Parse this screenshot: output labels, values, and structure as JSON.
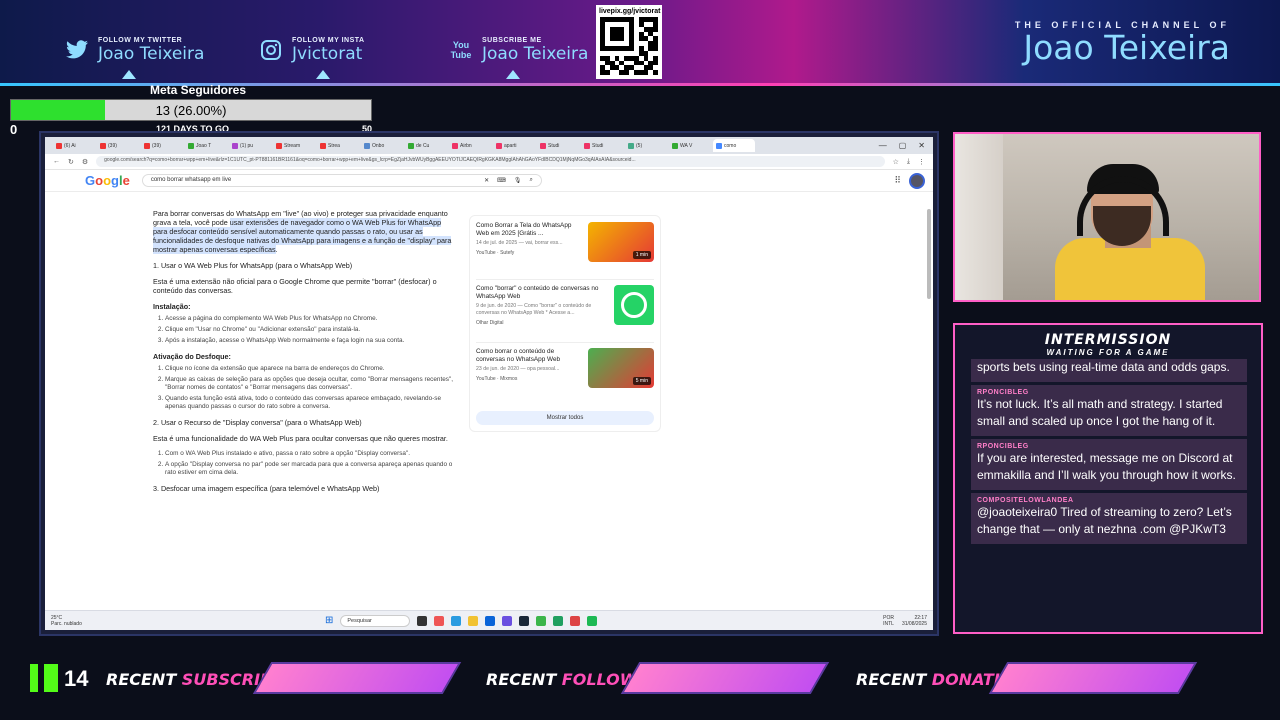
{
  "banner": {
    "twitter": {
      "small": "FOLLOW MY TWITTER",
      "name": "Joao Teixeira",
      "icon": "twitter-icon"
    },
    "insta": {
      "small": "FOLLOW MY INSTA",
      "name": "Jvictorat",
      "icon": "instagram-icon"
    },
    "youtube": {
      "small": "SUBSCRIBE ME",
      "name": "Joao Teixeira",
      "icon": "youtube-icon",
      "logo_text": "You Tube"
    },
    "qr_url": "livepix.gg/jvictorat",
    "official_line": "THE OFFICIAL CHANNEL OF",
    "official_name": "Joao Teixeira"
  },
  "goal": {
    "title": "Meta Seguidores",
    "count_text": "13 (26.00%)",
    "progress_percent": 26,
    "min": "0",
    "days": "121 DAYS TO GO",
    "max": "50",
    "fill_color": "#2ee02e"
  },
  "browser": {
    "tabs": [
      "(6) Ai",
      "(39)",
      "(39)",
      "Joao T",
      "(1) pu",
      "Stream",
      "Strea",
      "Onbo",
      "de Cu",
      "Airbn",
      "aparti",
      "Studi",
      "Studi",
      "(5)",
      "WA V",
      "como"
    ],
    "window_controls": [
      "—",
      "▢",
      "✕"
    ],
    "url": "google.com/search?q=como+borrar+wpp+em+live&rlz=1C1UTC_pt-PT881161BR1161&oq=como+borrar+wpp+em+live&gs_lcrp=EgZjaHJvbWUyBggAEEUYOTIJCAEQIRgKGKA8MggIAhAhGAoYFdIBCDQ1MjNqMGo3qAIAsAIA&sourceid...",
    "google_logo": "Google",
    "search_query": "como borrar whatsapp em live",
    "content": {
      "intro_plain": "Para borrar conversas do WhatsApp em \"live\" (ao vivo) e proteger sua privacidade enquanto grava a tela, você pode ",
      "intro_hl": "usar extensões de navegador como o WA Web Plus for WhatsApp para desfocar conteúdo sensível automaticamente quando passas o rato, ou usar as funcionalidades de desfoque nativas do WhatsApp para imagens e a função de \"display\" para mostrar apenas conversas específicas",
      "intro_end": ".",
      "s1_title": "1. Usar o WA Web Plus for WhatsApp (para o WhatsApp Web)",
      "s1_desc": "Esta é uma extensão não oficial para o Google Chrome que permite \"borrar\" (desfocar) o conteúdo das conversas.",
      "install_h": "Instalação:",
      "install_items": [
        "Acesse a página do complemento WA Web Plus for WhatsApp no Chrome.",
        "Clique em \"Usar no Chrome\" ou \"Adicionar extensão\" para instalá-la.",
        "Após a instalação, acesse o WhatsApp Web normalmente e faça login na sua conta."
      ],
      "activate_h": "Ativação do Desfoque:",
      "activate_items": [
        "Clique no ícone da extensão que aparece na barra de endereços do Chrome.",
        "Marque as caixas de seleção para as opções que deseja ocultar, como \"Borrar mensagens recentes\", \"Borrar nomes de contatos\" e \"Borrar mensagens das conversas\".",
        "Quando esta função está ativa, todo o conteúdo das conversas aparece embaçado, revelando-se apenas quando passas o cursor do rato sobre a conversa."
      ],
      "s2_title": "2. Usar o Recurso de \"Display conversa\" (para o WhatsApp Web)",
      "s2_desc": "Esta é uma funcionalidade do WA Web Plus para ocultar conversas que não queres mostrar.",
      "s2_items": [
        "Com o WA Web Plus instalado e ativo, passa o rato sobre a opção \"Display conversa\".",
        "A opção \"Display conversa no par\" pode ser marcada para que a conversa apareça apenas quando o rato estiver em cima dela."
      ],
      "s3_title": "3. Desfocar uma imagem específica (para telemóvel e WhatsApp Web)"
    },
    "side_cards": [
      {
        "title": "Como Borrar a Tela do WhatsApp Web em 2025 [Grátis ...",
        "meta": "14 de jul. de 2025 — vai, borrar ess...",
        "source": "YouTube · Sutefy",
        "duration": "1 min"
      },
      {
        "title": "Como \"borrar\" o conteúdo de conversas no WhatsApp Web",
        "meta": "9 de jun. de 2020 — Como \"borrar\" o conteúdo de conversas no WhatsApp Web * Acesse a...",
        "source": "Olhar Digital",
        "duration": ""
      },
      {
        "title": "Como borrar o conteúdo de conversas no WhatsApp Web",
        "meta": "23 de jun. de 2020 — opa pessoal...",
        "source": "YouTube · Mixmos",
        "duration": "5 min"
      }
    ],
    "show_all": "Mostrar todos",
    "taskbar": {
      "temp": "25°C",
      "weather": "Parc. nublado",
      "search": "Pesquisar",
      "lang1": "POR",
      "lang2": "INTL",
      "time": "22:17",
      "date": "31/08/2025"
    }
  },
  "chat": {
    "title": "INTERMISSION",
    "subtitle": "WAITING FOR A GAME",
    "messages": [
      {
        "user": "",
        "text": "sports bets using real-time data and odds gaps."
      },
      {
        "user": "RPONCIBLEG",
        "text": "It’s not luck. It’s all math and strategy. I started small and scaled up once I got the hang of it."
      },
      {
        "user": "RPONCIBLEG",
        "text": "If you are interested, message me on Discord at emmakilla and I’ll walk you through how it works."
      },
      {
        "user": "COMPOSITELOWLANDEA",
        "text": "@joaoteixeira0 Tired of streaming to zero? Let’s change that — only at nezhna .com @PJKwT3"
      }
    ]
  },
  "bottom": {
    "kick_count": "14",
    "subscriber": {
      "pre": "RECENT ",
      "acc": "SUBSCRIBER"
    },
    "follower": {
      "pre": "RECENT ",
      "acc": "FOLLOWER"
    },
    "donation": {
      "pre": "RECENT ",
      "acc": "DONATION"
    }
  }
}
